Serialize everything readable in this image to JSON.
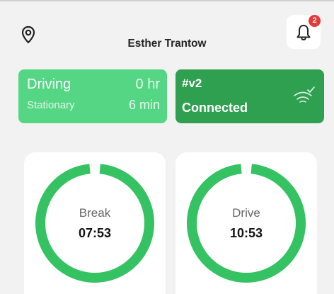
{
  "header": {
    "user_name": "Esther Trantow",
    "notification_count": "2"
  },
  "status_card": {
    "main_label": "Driving",
    "main_value": "0 hr",
    "sub_label": "Stationary",
    "sub_value": "6 min",
    "color": "#55d685"
  },
  "device_card": {
    "id": "#v2",
    "status": "Connected",
    "color": "#2ea04f"
  },
  "timers": [
    {
      "label": "Break",
      "value": "07:53",
      "progress": 0.97
    },
    {
      "label": "Drive",
      "value": "10:53",
      "progress": 0.97
    }
  ],
  "colors": {
    "ring": "#34c262",
    "badge": "#e53935"
  }
}
